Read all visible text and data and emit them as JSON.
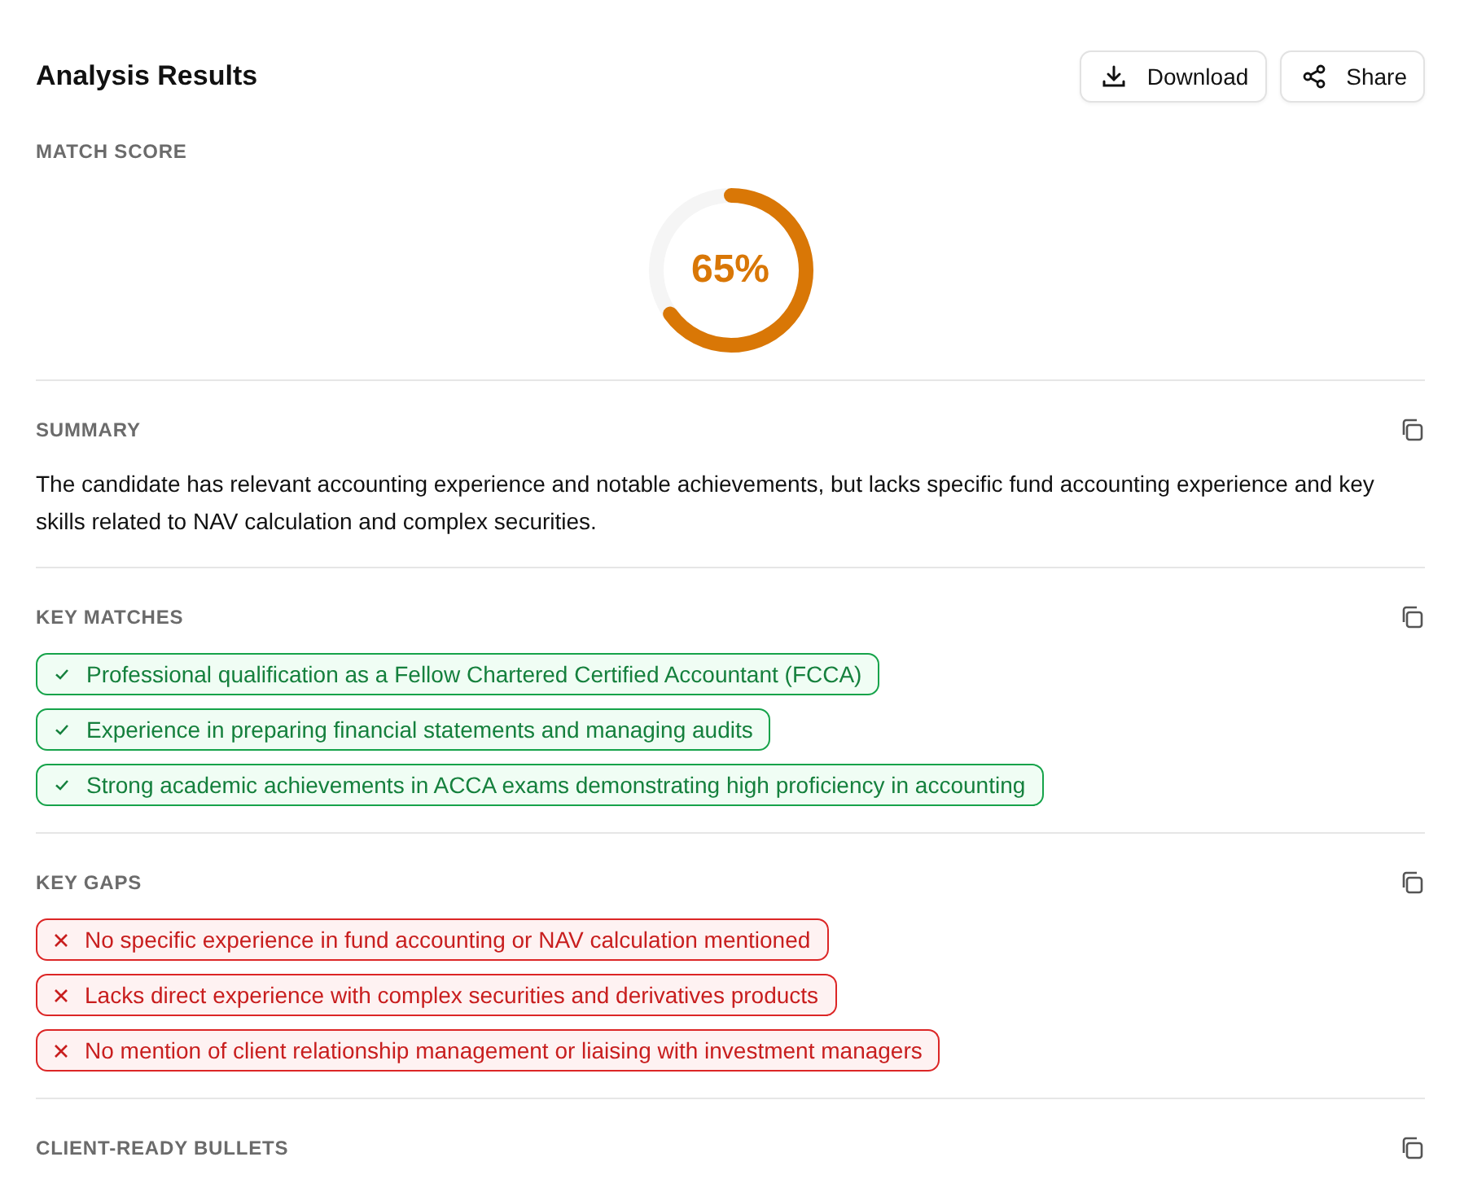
{
  "title": "Analysis Results",
  "actions": [
    {
      "kind": "download",
      "label": "Download"
    },
    {
      "kind": "share",
      "label": "Share"
    }
  ],
  "match_score": {
    "label": "MATCH SCORE",
    "value": "65%",
    "level": 0.65
  },
  "sections": [
    {
      "kind": "text",
      "heading": "SUMMARY",
      "text": "The candidate has relevant accounting experience and notable achievements, but lacks specific fund accounting experience and key skills related to NAV calculation and complex securities."
    },
    {
      "kind": "matches",
      "heading": "KEY MATCHES",
      "items": [
        "Professional qualification as a Fellow Chartered Certified Accountant (FCCA)",
        "Experience in preparing financial statements and managing audits",
        "Strong academic achievements in ACCA exams demonstrating high proficiency in accounting"
      ]
    },
    {
      "kind": "gaps",
      "heading": "KEY GAPS",
      "items": [
        "No specific experience in fund accounting or NAV calculation mentioned",
        "Lacks direct experience with complex securities and derivatives products",
        "No mention of client relationship management or liaising with investment managers"
      ]
    },
    {
      "kind": "empty",
      "heading": "CLIENT-READY BULLETS"
    }
  ]
}
